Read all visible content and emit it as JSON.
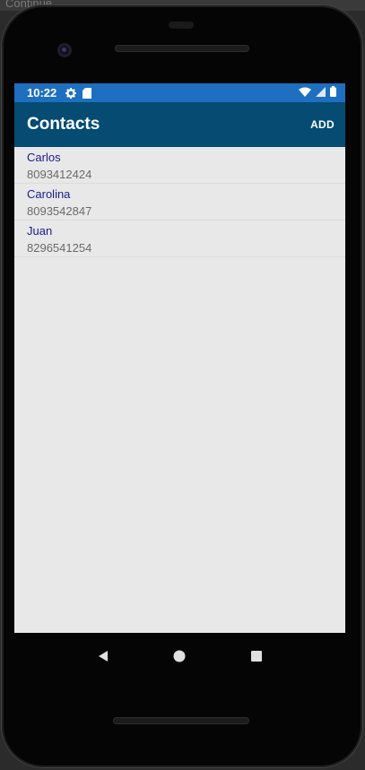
{
  "host": {
    "window_title": "Continue"
  },
  "status_bar": {
    "time": "10:22",
    "icons": [
      "settings-icon",
      "sd-card-icon",
      "wifi-icon",
      "signal-icon",
      "battery-icon"
    ],
    "color": "#1e6fbf"
  },
  "app_bar": {
    "title": "Contacts",
    "add_label": "ADD",
    "color": "#054b72"
  },
  "contacts": [
    {
      "name": "Carlos",
      "phone": "8093412424"
    },
    {
      "name": "Carolina",
      "phone": "8093542847"
    },
    {
      "name": "Juan",
      "phone": "8296541254"
    }
  ],
  "nav_bar": {
    "icons": [
      "back-icon",
      "home-icon",
      "recents-icon"
    ]
  }
}
